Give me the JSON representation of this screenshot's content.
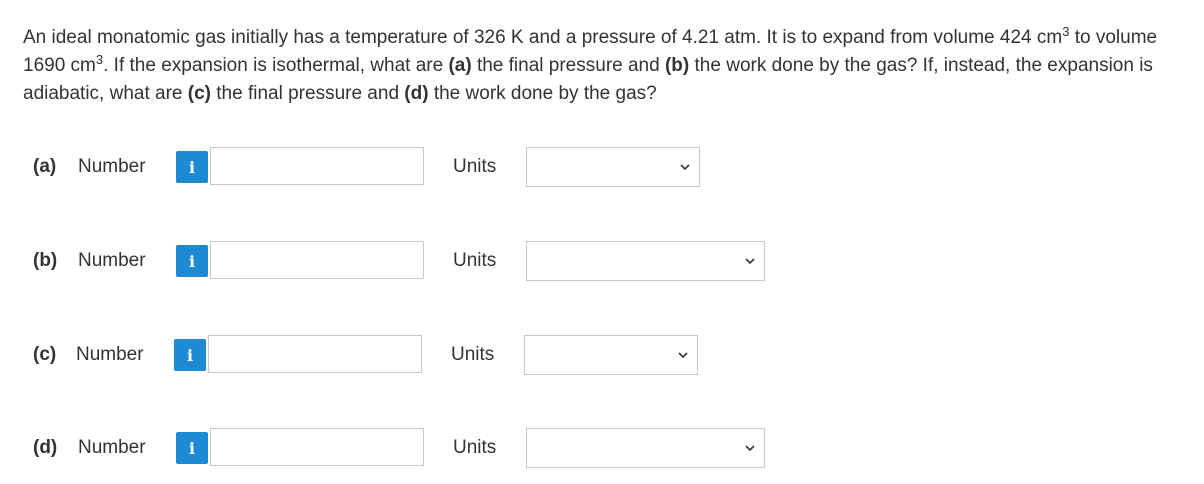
{
  "question": {
    "s1": "An ideal monatomic gas initially has a temperature of 326 K and a pressure of 4.21 atm. It is to expand from volume 424 cm",
    "exp1": "3",
    "s2": " to volume 1690 cm",
    "exp2": "3",
    "s3": ". If the expansion is isothermal, what are ",
    "a": "(a)",
    "s4": " the final pressure and ",
    "b": "(b)",
    "s5": " the work done by the gas? If, instead, the expansion is adiabatic, what are ",
    "c": "(c)",
    "s6": " the final pressure and ",
    "d": "(d)",
    "s7": " the work done by the gas?"
  },
  "parts": [
    {
      "label": "(a)",
      "number_label": "Number",
      "info": "i",
      "value": "",
      "units_label": "Units",
      "units_value": ""
    },
    {
      "label": "(b)",
      "number_label": "Number",
      "info": "i",
      "value": "",
      "units_label": "Units",
      "units_value": ""
    },
    {
      "label": "(c)",
      "number_label": "Number",
      "info": "i",
      "value": "",
      "units_label": "Units",
      "units_value": ""
    },
    {
      "label": "(d)",
      "number_label": "Number",
      "info": "i",
      "value": "",
      "units_label": "Units",
      "units_value": ""
    }
  ],
  "colors": {
    "info_button": "#1f8ad4",
    "border": "#c8c8c8",
    "text": "#333333"
  },
  "icons": {
    "info": "info-icon",
    "dropdown": "chevron-down-icon"
  }
}
